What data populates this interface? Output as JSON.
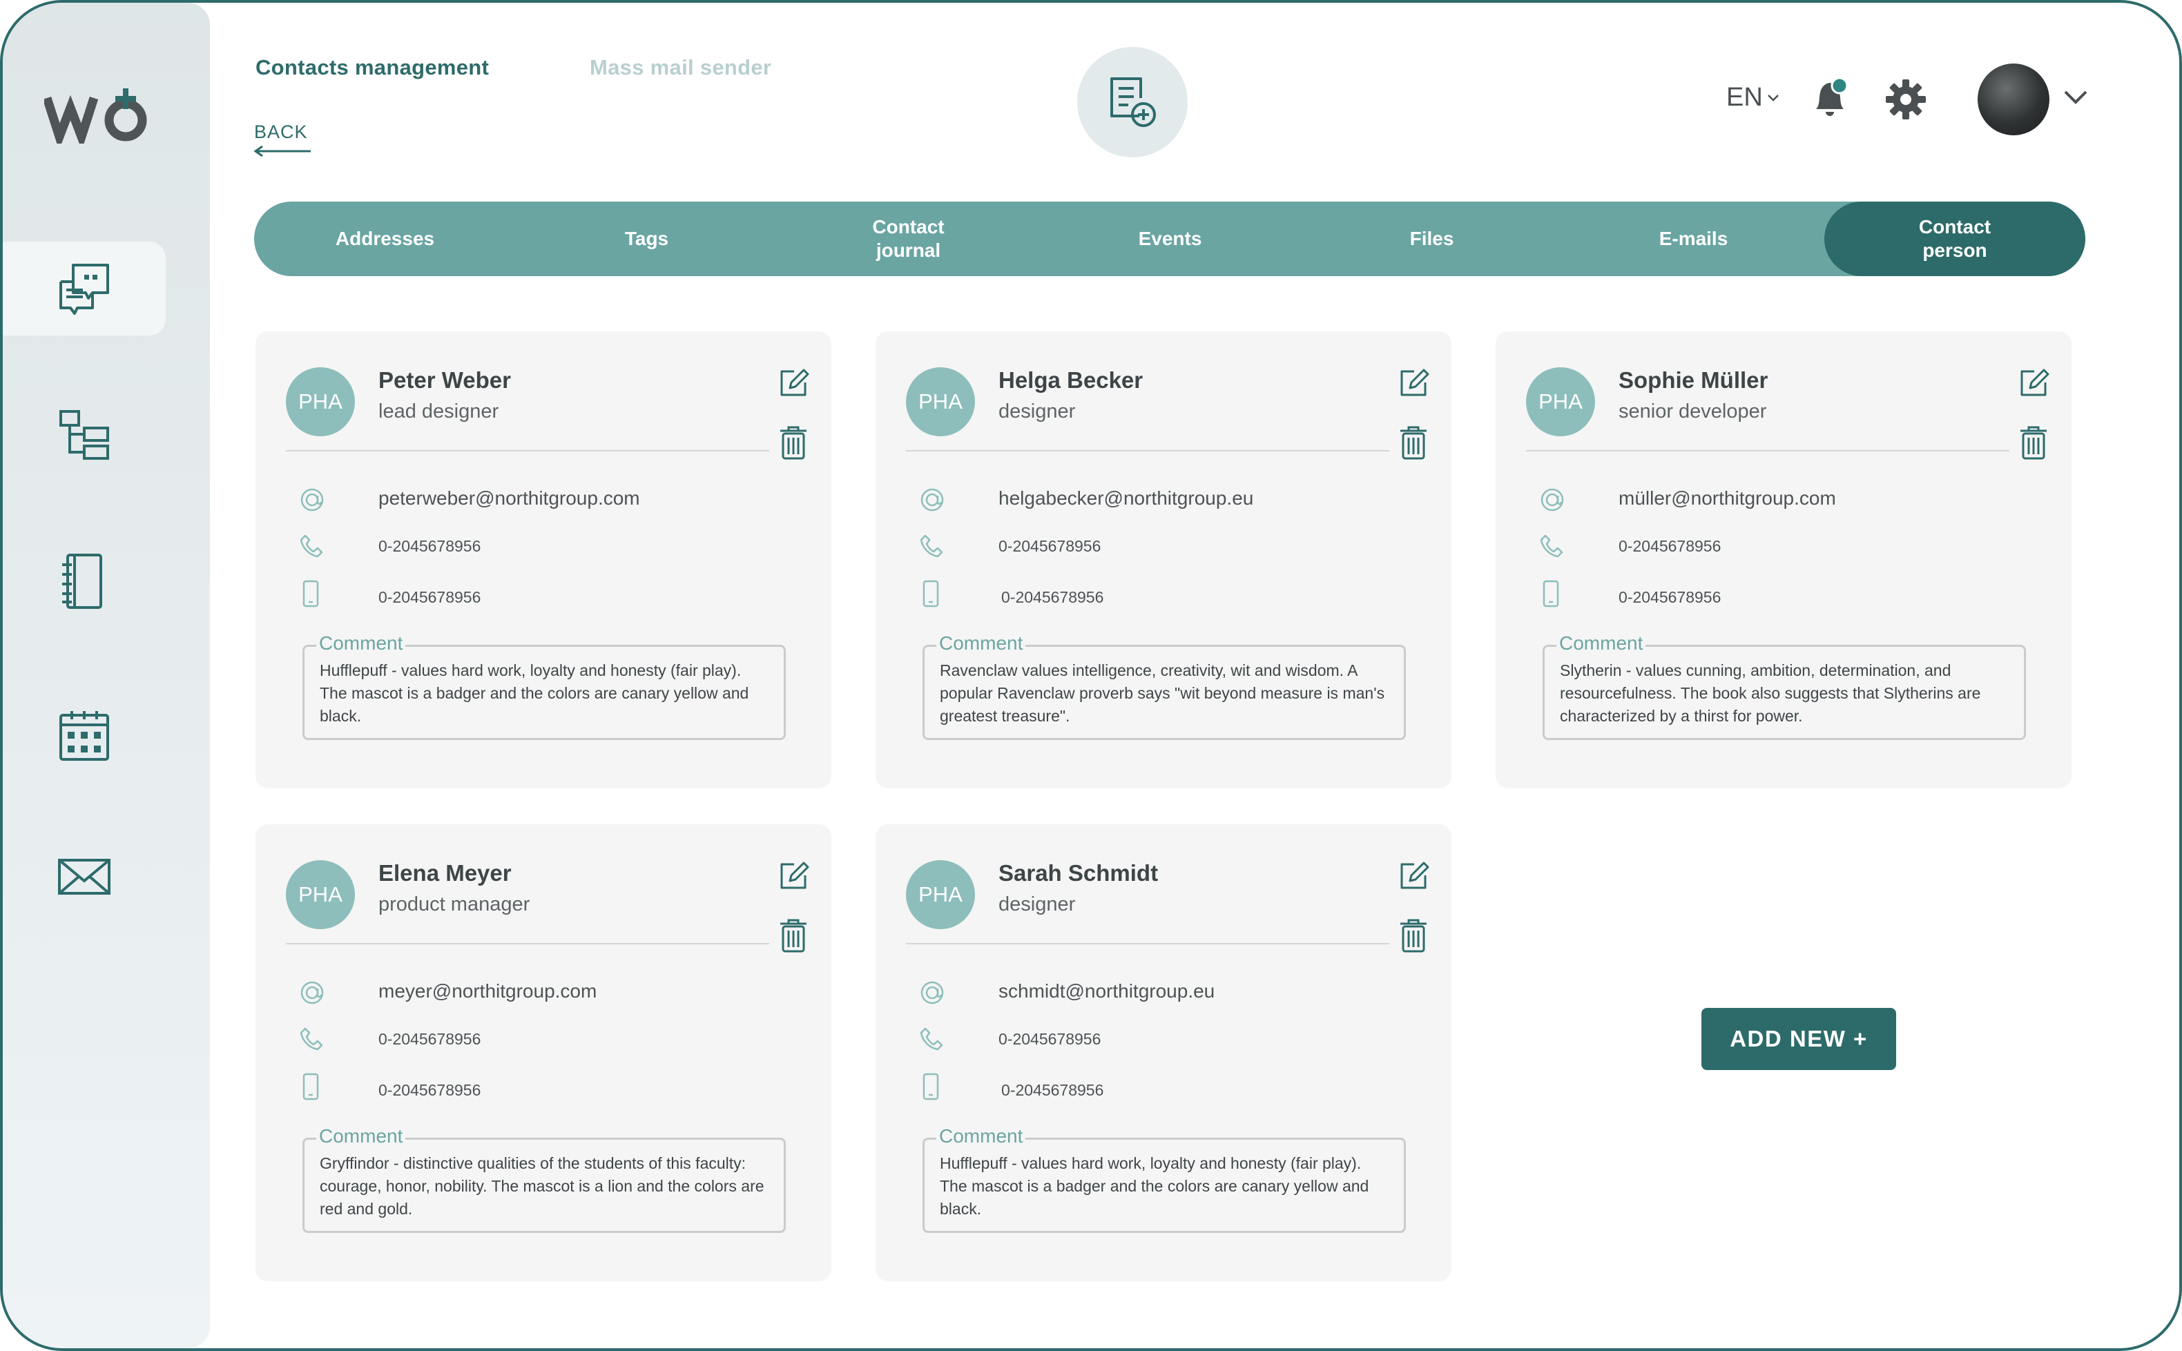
{
  "header": {
    "tab_active": "Contacts management",
    "tab_inactive": "Mass mail sender",
    "back_label": "BACK",
    "language": "EN"
  },
  "tabs": [
    {
      "label": "Addresses"
    },
    {
      "label": "Tags"
    },
    {
      "label": "Contact\njournal"
    },
    {
      "label": "Events"
    },
    {
      "label": "Files"
    },
    {
      "label": "E-mails"
    },
    {
      "label": "Contact\nperson"
    }
  ],
  "comment_label": "Comment",
  "contacts": [
    {
      "initials": "PHA",
      "name": "Peter Weber",
      "role": "lead designer",
      "email": "peterweber@northitgroup.com",
      "phone": "0-2045678956",
      "mobile": "0-2045678956",
      "comment": "Hufflepuff - values hard work, loyalty and honesty (fair play). The mascot is a badger and the colors are canary yellow and black."
    },
    {
      "initials": "PHA",
      "name": "Helga Becker",
      "role": "designer",
      "email": "helgabecker@northitgroup.eu",
      "phone": "0-2045678956",
      "mobile": "0-2045678956",
      "comment": "Ravenclaw values intelligence, creativity, wit and wisdom. A popular Ravenclaw proverb says \"wit beyond measure is man's greatest treasure\"."
    },
    {
      "initials": "PHA",
      "name": "Sophie Müller",
      "role": "senior developer",
      "email": "müller@northitgroup.com",
      "phone": "0-2045678956",
      "mobile": "0-2045678956",
      "comment": "Slytherin - values cunning, ambition, determination, and resourcefulness. The book also suggests that Slytherins are characterized by a thirst for power."
    },
    {
      "initials": "PHA",
      "name": "Elena Meyer",
      "role": "product manager",
      "email": "meyer@northitgroup.com",
      "phone": "0-2045678956",
      "mobile": "0-2045678956",
      "comment": "Gryffindor - distinctive qualities of the students of this faculty: courage, honor, nobility. The mascot is a lion and the colors are red and gold."
    },
    {
      "initials": "PHA",
      "name": "Sarah Schmidt",
      "role": "designer",
      "email": "schmidt@northitgroup.eu",
      "phone": "0-2045678956",
      "mobile": "0-2045678956",
      "comment": "Hufflepuff - values hard work, loyalty and honesty (fair play). The mascot is a badger and the colors are canary yellow and black."
    }
  ],
  "add_new_label": "ADD NEW  +",
  "colors": {
    "primary": "#2c6b69",
    "tabbar": "#6aa5a2",
    "avatar": "#8dbebb",
    "notification_dot": "#2e8580"
  }
}
